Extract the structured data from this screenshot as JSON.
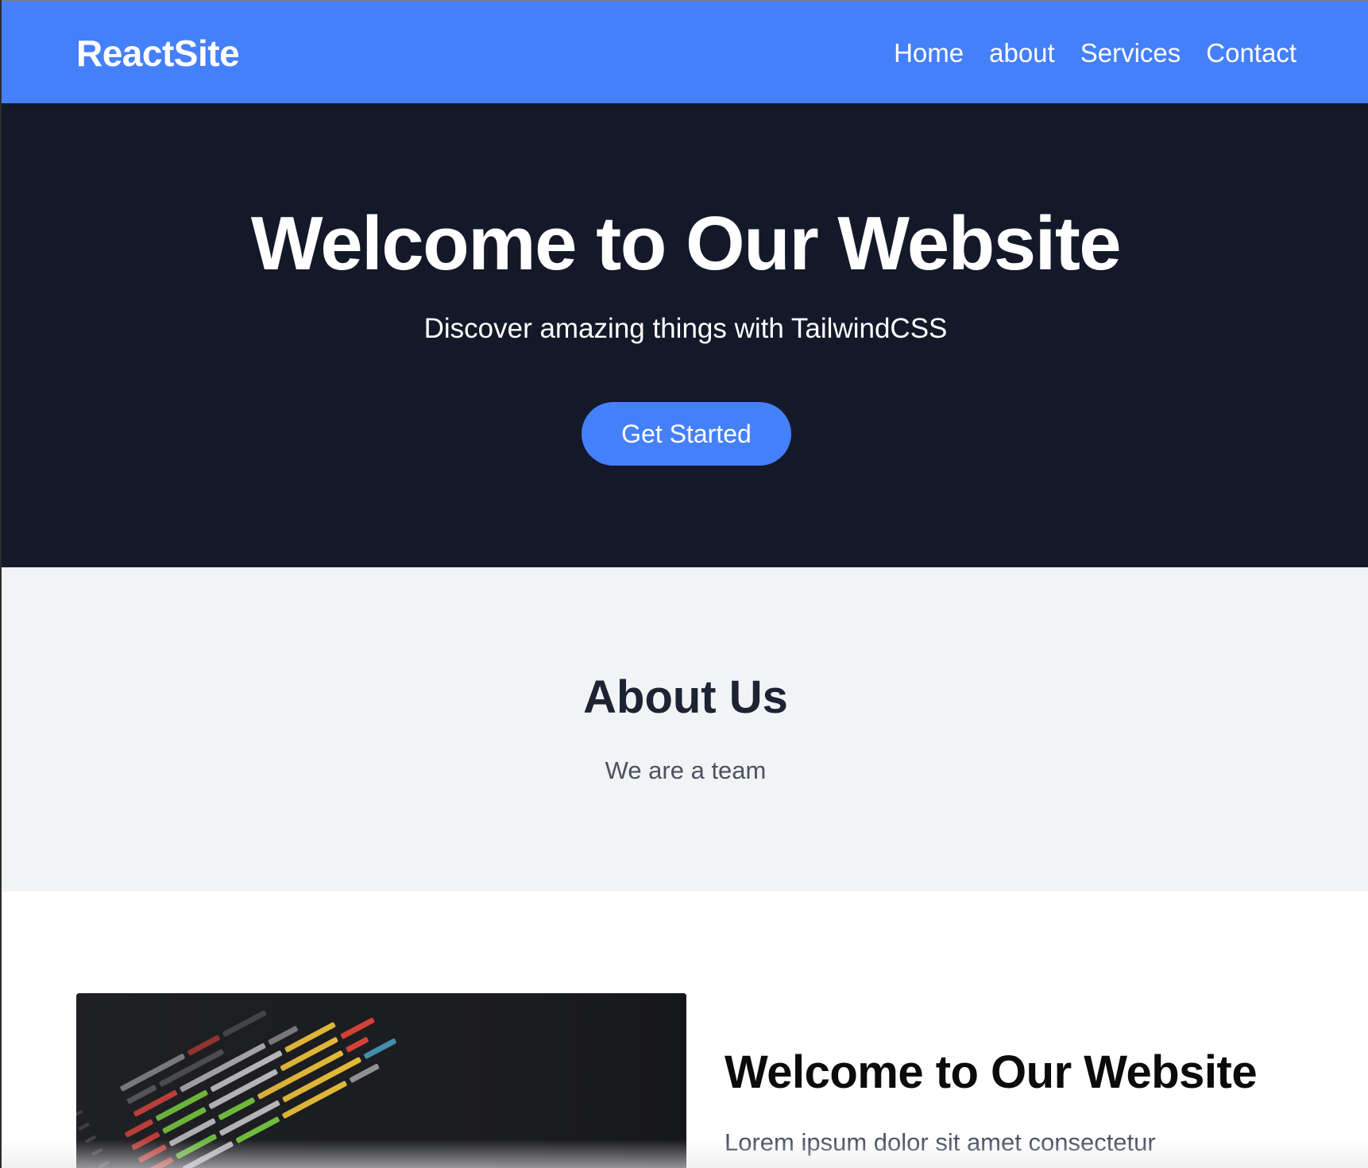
{
  "navbar": {
    "brand": "ReactSite",
    "links": [
      {
        "label": "Home"
      },
      {
        "label": "about"
      },
      {
        "label": "Services"
      },
      {
        "label": "Contact"
      }
    ]
  },
  "hero": {
    "title": "Welcome to Our Website",
    "subtitle": "Discover amazing things with TailwindCSS",
    "button_label": "Get Started"
  },
  "about": {
    "title": "About Us",
    "text": "We are a team"
  },
  "feature": {
    "title": "Welcome to Our Website",
    "text": "Lorem ipsum dolor sit amet consectetur"
  },
  "colors": {
    "primary": "#4580fb",
    "hero_bg": "#131929",
    "about_bg": "#f2f3f5",
    "heading_dark": "#1c2333",
    "body_gray": "#4a5261"
  }
}
